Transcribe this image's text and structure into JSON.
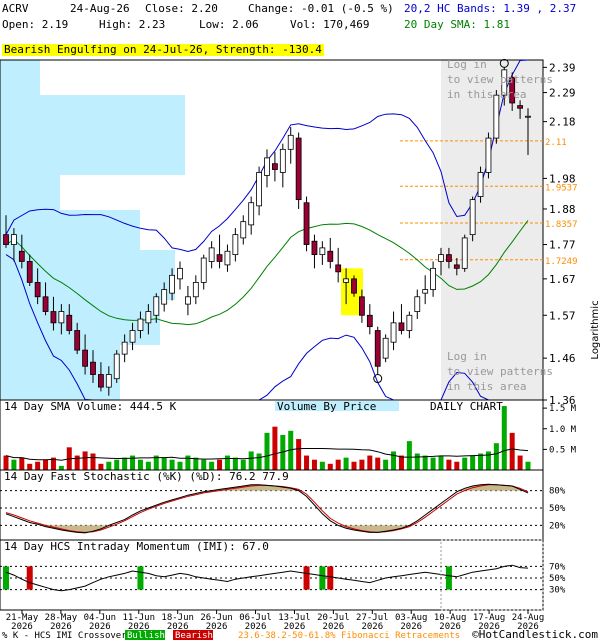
{
  "header": {
    "symbol": "ACRV",
    "date": "24-Aug-26",
    "close_label": "Close: 2.20",
    "change_label": "Change: -0.01 (-0.5 %)",
    "open_label": "Open: 2.19",
    "high_label": "High: 2.23",
    "low_label": "Low: 2.06",
    "vol_label": "Vol: 170,469",
    "bands_label": "20,2 HC Bands: 1.39 , 2.37",
    "sma_label": "20 Day SMA: 1.81",
    "pattern_banner": "Bearish Engulfing on 24-Jul-26, Strength: -130.4"
  },
  "login_notes": [
    "Log in to view patterns in this area",
    "Log in to view patterns in this area"
  ],
  "colors": {
    "bull": "#ffffff",
    "bear": "#990033",
    "band": "#0000cc",
    "sma": "#008000",
    "vbp": "#bfefff",
    "vol_up": "#00aa00",
    "vol_down": "#cc0000",
    "highlight": "#ffff00",
    "fib": "#ff8c00",
    "stoch_fill": "#c8b98c",
    "login_area": "#ececec"
  },
  "panels": {
    "volume_title": "14 Day SMA Volume: 444.5 K",
    "vbp_title": "Volume By Price",
    "daily_chart": "DAILY CHART",
    "stoch_title": "14 Day Fast Stochastic (%K) (%D): 76.2  77.9",
    "imi_title": "14 Day HCS Intraday Momentum (IMI): 67.0"
  },
  "footer": {
    "crossover": "% K - HCS IMI Crossover:",
    "bullish": "Bullish",
    "bearish": "Bearish",
    "fib_note": "23.6-38.2-50-61.8% Fibonacci Retracements",
    "copyright": "©HotCandlestick.com",
    "date_ticks": [
      "21-May 2026",
      "28-May 2026",
      "04-Jun 2026",
      "11-Jun 2026",
      "18-Jun 2026",
      "26-Jun 2026",
      "06-Jul 2026",
      "13-Jul 2026",
      "20-Jul 2026",
      "27-Jul 2026",
      "03-Aug 2026",
      "10-Aug 2026",
      "17-Aug 2026",
      "24-Aug 2026"
    ]
  },
  "chart_data": [
    {
      "type": "candlestick",
      "scale": "log",
      "ylim": [
        1.36,
        2.42
      ],
      "yticks": [
        "2.39",
        "2.29",
        "2.18",
        "1.98",
        "1.88",
        "1.77",
        "1.67",
        "1.57",
        "1.46",
        "1.36"
      ],
      "fib_levels": [
        "2.11",
        "1.9537",
        "1.8357",
        "1.7249"
      ],
      "ohlc": [
        [
          1.8,
          1.86,
          1.76,
          1.77
        ],
        [
          1.77,
          1.82,
          1.72,
          1.8
        ],
        [
          1.75,
          1.8,
          1.7,
          1.72
        ],
        [
          1.72,
          1.74,
          1.65,
          1.66
        ],
        [
          1.66,
          1.7,
          1.6,
          1.62
        ],
        [
          1.62,
          1.66,
          1.57,
          1.58
        ],
        [
          1.58,
          1.62,
          1.53,
          1.55
        ],
        [
          1.55,
          1.6,
          1.52,
          1.58
        ],
        [
          1.57,
          1.6,
          1.52,
          1.53
        ],
        [
          1.53,
          1.55,
          1.47,
          1.48
        ],
        [
          1.48,
          1.52,
          1.42,
          1.44
        ],
        [
          1.45,
          1.48,
          1.4,
          1.42
        ],
        [
          1.42,
          1.45,
          1.38,
          1.39
        ],
        [
          1.39,
          1.44,
          1.37,
          1.42
        ],
        [
          1.41,
          1.48,
          1.4,
          1.47
        ],
        [
          1.47,
          1.52,
          1.45,
          1.5
        ],
        [
          1.5,
          1.55,
          1.48,
          1.53
        ],
        [
          1.53,
          1.58,
          1.51,
          1.56
        ],
        [
          1.55,
          1.6,
          1.52,
          1.58
        ],
        [
          1.57,
          1.63,
          1.55,
          1.62
        ],
        [
          1.6,
          1.66,
          1.58,
          1.64
        ],
        [
          1.63,
          1.7,
          1.61,
          1.68
        ],
        [
          1.67,
          1.72,
          1.64,
          1.7
        ],
        [
          1.6,
          1.65,
          1.57,
          1.62
        ],
        [
          1.62,
          1.68,
          1.6,
          1.66
        ],
        [
          1.66,
          1.74,
          1.64,
          1.73
        ],
        [
          1.72,
          1.78,
          1.7,
          1.76
        ],
        [
          1.74,
          1.8,
          1.7,
          1.72
        ],
        [
          1.71,
          1.77,
          1.69,
          1.75
        ],
        [
          1.74,
          1.82,
          1.72,
          1.8
        ],
        [
          1.79,
          1.86,
          1.77,
          1.84
        ],
        [
          1.83,
          1.92,
          1.8,
          1.9
        ],
        [
          1.89,
          2.02,
          1.86,
          2.0
        ],
        [
          1.99,
          2.08,
          1.95,
          2.05
        ],
        [
          2.03,
          2.07,
          1.97,
          2.01
        ],
        [
          2.0,
          2.1,
          1.95,
          2.08
        ],
        [
          2.08,
          2.16,
          2.03,
          2.13
        ],
        [
          2.12,
          2.14,
          1.88,
          1.91
        ],
        [
          1.9,
          1.92,
          1.75,
          1.77
        ],
        [
          1.78,
          1.8,
          1.7,
          1.74
        ],
        [
          1.74,
          1.78,
          1.71,
          1.76
        ],
        [
          1.75,
          1.79,
          1.7,
          1.72
        ],
        [
          1.71,
          1.76,
          1.66,
          1.69
        ],
        [
          1.66,
          1.7,
          1.6,
          1.67
        ],
        [
          1.67,
          1.68,
          1.62,
          1.63
        ],
        [
          1.62,
          1.64,
          1.55,
          1.57
        ],
        [
          1.57,
          1.6,
          1.52,
          1.54
        ],
        [
          1.53,
          1.54,
          1.42,
          1.44
        ],
        [
          1.46,
          1.52,
          1.45,
          1.51
        ],
        [
          1.5,
          1.58,
          1.48,
          1.55
        ],
        [
          1.55,
          1.6,
          1.52,
          1.53
        ],
        [
          1.53,
          1.58,
          1.51,
          1.57
        ],
        [
          1.58,
          1.64,
          1.56,
          1.62
        ],
        [
          1.63,
          1.68,
          1.6,
          1.64
        ],
        [
          1.64,
          1.72,
          1.62,
          1.7
        ],
        [
          1.72,
          1.76,
          1.68,
          1.74
        ],
        [
          1.74,
          1.76,
          1.7,
          1.72
        ],
        [
          1.71,
          1.73,
          1.68,
          1.7
        ],
        [
          1.7,
          1.8,
          1.69,
          1.79
        ],
        [
          1.8,
          1.92,
          1.78,
          1.91
        ],
        [
          1.92,
          2.02,
          1.9,
          2.0
        ],
        [
          2.0,
          2.14,
          1.98,
          2.12
        ],
        [
          2.12,
          2.3,
          2.1,
          2.28
        ],
        [
          2.28,
          2.39,
          2.24,
          2.38
        ],
        [
          2.35,
          2.37,
          2.22,
          2.25
        ],
        [
          2.24,
          2.26,
          2.19,
          2.23
        ],
        [
          2.2,
          2.23,
          2.06,
          2.2
        ]
      ]
    },
    {
      "type": "bar",
      "title": "14 Day SMA Volume",
      "ylabel_ticks": [
        "1.5 M",
        "1.0 M",
        "0.5 M"
      ],
      "ylim": [
        0,
        1.6
      ],
      "values": [
        0.35,
        0.25,
        0.3,
        0.15,
        0.2,
        0.25,
        0.3,
        0.1,
        0.55,
        0.35,
        0.45,
        0.4,
        0.15,
        0.2,
        0.25,
        0.3,
        0.35,
        0.25,
        0.2,
        0.35,
        0.3,
        0.25,
        0.2,
        0.35,
        0.3,
        0.25,
        0.2,
        0.25,
        0.35,
        0.3,
        0.25,
        0.45,
        0.4,
        0.9,
        1.05,
        0.85,
        0.95,
        0.75,
        0.35,
        0.25,
        0.2,
        0.15,
        0.25,
        0.3,
        0.2,
        0.25,
        0.35,
        0.3,
        0.25,
        0.45,
        0.35,
        0.7,
        0.4,
        0.35,
        0.3,
        0.35,
        0.25,
        0.2,
        0.3,
        0.35,
        0.4,
        0.45,
        0.65,
        1.55,
        0.9,
        0.35,
        0.2
      ]
    },
    {
      "type": "line",
      "title": "14 Day Fast Stochastic",
      "ylabel_ticks": [
        "80%",
        "50%",
        "20%"
      ],
      "ylim": [
        0,
        100
      ],
      "series": [
        {
          "name": "%K",
          "values": [
            40,
            35,
            30,
            25,
            22,
            18,
            15,
            12,
            10,
            8,
            7,
            10,
            14,
            20,
            25,
            30,
            38,
            45,
            50,
            55,
            60,
            64,
            68,
            72,
            75,
            78,
            80,
            82,
            84,
            86,
            88,
            90,
            90,
            89,
            88,
            86,
            84,
            80,
            70,
            55,
            40,
            28,
            20,
            15,
            12,
            10,
            8,
            8,
            10,
            12,
            15,
            20,
            28,
            38,
            48,
            58,
            68,
            78,
            84,
            88,
            90,
            91,
            90,
            89,
            88,
            82,
            76
          ]
        },
        {
          "name": "%D",
          "values": [
            42,
            38,
            33,
            28,
            24,
            20,
            17,
            14,
            11,
            9,
            8,
            9,
            12,
            17,
            22,
            28,
            35,
            42,
            48,
            53,
            58,
            62,
            66,
            70,
            73,
            76,
            78,
            80,
            82,
            84,
            86,
            88,
            89,
            89,
            88,
            87,
            85,
            82,
            74,
            60,
            45,
            32,
            24,
            18,
            14,
            11,
            9,
            8,
            9,
            11,
            14,
            18,
            25,
            34,
            44,
            54,
            64,
            74,
            80,
            85,
            88,
            90,
            90,
            89,
            88,
            84,
            78
          ]
        }
      ]
    },
    {
      "type": "line",
      "title": "14 Day HCS Intraday Momentum (IMI)",
      "ylabel_ticks": [
        "70%",
        "50%",
        "30%"
      ],
      "ylim": [
        0,
        100
      ],
      "values": [
        60,
        55,
        48,
        42,
        38,
        34,
        30,
        28,
        30,
        33,
        36,
        42,
        48,
        52,
        55,
        58,
        62,
        60,
        58,
        54,
        52,
        55,
        58,
        56,
        52,
        50,
        48,
        46,
        44,
        48,
        50,
        52,
        54,
        56,
        58,
        60,
        62,
        60,
        58,
        56,
        54,
        52,
        50,
        48,
        46,
        44,
        42,
        46,
        50,
        52,
        54,
        56,
        58,
        60,
        58,
        56,
        54,
        52,
        56,
        60,
        62,
        64,
        66,
        70,
        72,
        68,
        67
      ],
      "crossover_marks": [
        {
          "index": 0,
          "kind": "bullish"
        },
        {
          "index": 3,
          "kind": "bearish"
        },
        {
          "index": 17,
          "kind": "bullish"
        },
        {
          "index": 38,
          "kind": "bearish"
        },
        {
          "index": 40,
          "kind": "bullish"
        },
        {
          "index": 41,
          "kind": "bearish"
        },
        {
          "index": 56,
          "kind": "bullish"
        }
      ]
    }
  ]
}
